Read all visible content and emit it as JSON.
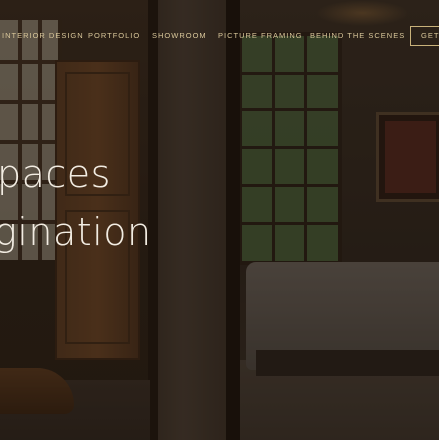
{
  "nav": {
    "items": [
      {
        "label": "INTERIOR DESIGN"
      },
      {
        "label": "PORTFOLIO"
      },
      {
        "label": "SHOWROOM"
      },
      {
        "label": "PICTURE FRAMING"
      },
      {
        "label": "BEHIND THE SCENES"
      }
    ],
    "cta_label": "GET IN TOUCH"
  },
  "hero": {
    "line1": "paces",
    "line2": "gination"
  },
  "colors": {
    "accent_gold": "#d9c79a",
    "hero_text": "#f2ece2"
  }
}
